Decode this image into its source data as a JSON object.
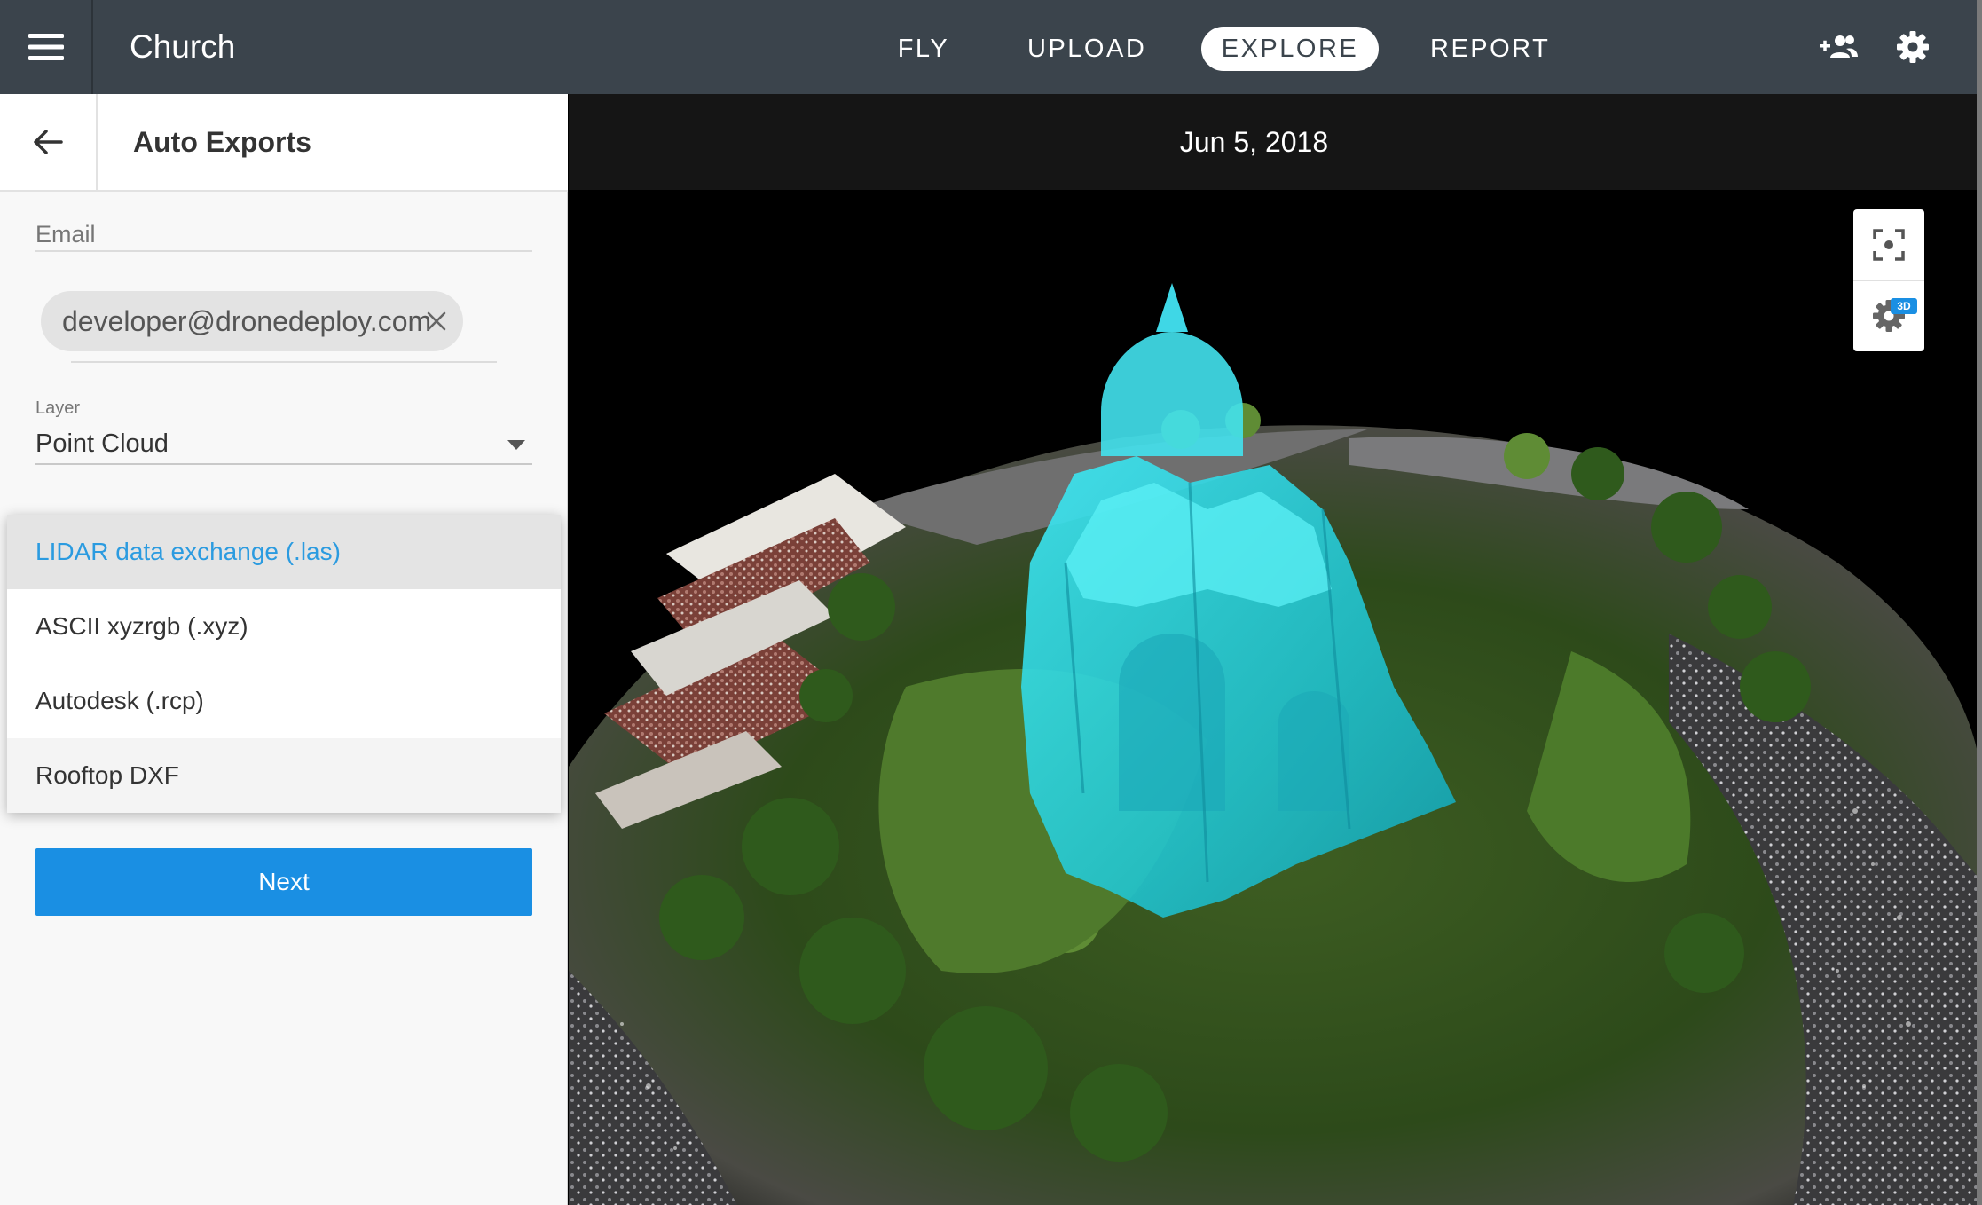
{
  "header": {
    "project_title": "Church",
    "tabs": [
      {
        "label": "FLY",
        "active": false
      },
      {
        "label": "UPLOAD",
        "active": false
      },
      {
        "label": "EXPLORE",
        "active": true
      },
      {
        "label": "REPORT",
        "active": false
      }
    ],
    "icons": [
      "menu-icon",
      "add-people-icon",
      "settings-gear-icon"
    ]
  },
  "panel": {
    "title": "Auto Exports",
    "back_icon": "arrow-left-icon",
    "email": {
      "label": "Email",
      "chip_value": "developer@dronedeploy.com"
    },
    "layer": {
      "label": "Layer",
      "value": "Point Cloud"
    },
    "file_type": {
      "options": [
        {
          "label": "LIDAR data exchange (.las)",
          "selected": true
        },
        {
          "label": "ASCII xyzrgb (.xyz)",
          "selected": false
        },
        {
          "label": "Autodesk (.rcp)",
          "selected": false
        },
        {
          "label": "Rooftop DXF",
          "selected": false
        }
      ]
    },
    "next_label": "Next"
  },
  "viewer": {
    "date": "Jun 5, 2018",
    "toolbar": {
      "recenter_icon": "recenter-icon",
      "settings_icon": "settings-3d-icon",
      "badge": "3D"
    }
  },
  "colors": {
    "topbar": "#3b444c",
    "accent": "#1a8fe3",
    "selected_option": "#2b9be0",
    "model_overlay": "#20d6e6"
  }
}
